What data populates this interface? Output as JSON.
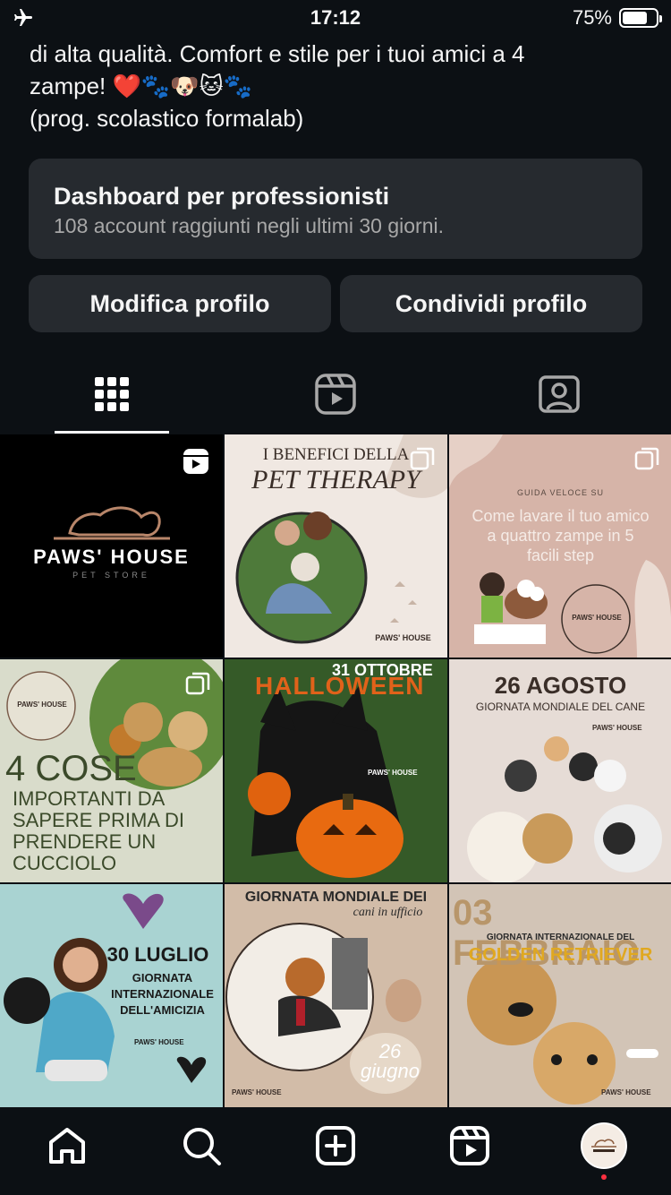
{
  "status": {
    "time": "17:12",
    "battery": "75%",
    "battery_level": 0.75
  },
  "bio": {
    "line1": "di alta qualità. Comfort e stile per i tuoi amici a 4",
    "line2": "zampe! ❤️🐾🐶🐱🐾",
    "line3": "(prog. scolastico formalab)"
  },
  "dashboard": {
    "title": "Dashboard per professionisti",
    "subtitle": "108 account raggiunti negli ultimi 30 giorni."
  },
  "buttons": {
    "edit": "Modifica profilo",
    "share": "Condividi profilo"
  },
  "tabs": [
    "grid-icon",
    "reels-icon",
    "tagged-icon"
  ],
  "posts": [
    {
      "title": "PAWS' HOUSE",
      "subtitle": "PET STORE",
      "type": "reel"
    },
    {
      "title": "I BENEFICI DELLA",
      "subtitle": "PET THERAPY",
      "brand": "PAWS' HOUSE",
      "type": "carousel"
    },
    {
      "title": "Come lavare il tuo amico a quattro zampe in 5 facili step",
      "subtitle": "GUIDA VELOCE SU",
      "brand": "PAWS' HOUSE",
      "type": "carousel"
    },
    {
      "title": "4 COSE",
      "subtitle": "IMPORTANTI DA SAPERE PRIMA DI PRENDERE UN CUCCIOLO",
      "brand": "PAWS' HOUSE",
      "type": "carousel"
    },
    {
      "title": "HALLOWEEN",
      "subtitle": "31 OTTOBRE",
      "brand": "PAWS' HOUSE",
      "type": "post"
    },
    {
      "title": "26 AGOSTO",
      "subtitle": "GIORNATA MONDIALE DEL CANE",
      "brand": "PAWS' HOUSE",
      "type": "post"
    },
    {
      "title": "30 LUGLIO",
      "subtitle": "GIORNATA INTERNAZIONALE DELL'AMICIZIA",
      "brand": "PAWS' HOUSE",
      "type": "post"
    },
    {
      "title": "GIORNATA MONDIALE DEI",
      "subtitle": "cani in ufficio",
      "date": "26 giugno",
      "brand": "PAWS' HOUSE",
      "type": "post"
    },
    {
      "title": "03 FEBBRAIO",
      "subtitle": "GIORNATA INTERNAZIONALE DEL",
      "highlight": "GOLDEN RETRIEVER",
      "brand": "PAWS' HOUSE",
      "type": "post"
    }
  ],
  "nav": [
    "home-icon",
    "search-icon",
    "create-icon",
    "reels-icon",
    "profile-avatar"
  ],
  "colors": {
    "background": "#0c1014",
    "card": "#262a2f",
    "text": "#f5f5f5",
    "muted": "#a8a8a8",
    "notification": "#ff3040"
  }
}
